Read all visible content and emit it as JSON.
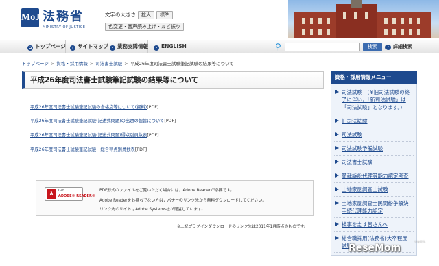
{
  "header": {
    "logo_mark": "MoJ",
    "logo_jp": "法務省",
    "logo_en": "MINISTRY OF JUSTICE",
    "font_size_label": "文字の大きさ",
    "font_large": "拡大",
    "font_standard": "標準",
    "accessibility": "色変更・音声読み上げ・ルビ振り"
  },
  "nav": {
    "items": [
      {
        "label": "トップページ",
        "icon": "house-icon"
      },
      {
        "label": "サイトマップ",
        "icon": "chevron-right-icon"
      },
      {
        "label": "業務支障情報",
        "icon": "chevron-right-icon"
      },
      {
        "label": "ENGLISH",
        "icon": "chevron-right-icon"
      }
    ],
    "search_placeholder": "",
    "search_button": "検索",
    "advanced_search": "詳細検索"
  },
  "breadcrumb": {
    "items": [
      "トップページ",
      "資格・採用情報",
      "司法書士試験"
    ],
    "current": "平成26年度司法書士試験筆記試験の結果等について"
  },
  "page_title": "平成26年度司法書士試験筆記試験の結果等について",
  "documents": [
    {
      "text": "平成26年度司法書士試験筆記試験の合格点等について(資料)",
      "suffix": "[PDF]"
    },
    {
      "text": "平成26年度司法書士試験筆記試験(記述式問題)の出題の趣旨について",
      "suffix": "[PDF]"
    },
    {
      "text": "平成26年度司法書士試験筆記試験(記述式問題)得点別員数表",
      "suffix": "[PDF]"
    },
    {
      "text": "平成26年度司法書士試験筆記試験　総合得点別員数表",
      "suffix": "[PDF]"
    }
  ],
  "adobe": {
    "badge_small": "Get",
    "badge_main": "ADOBE® READER®",
    "lines": [
      "PDF形式のファイルをご覧いただく場合には，Adobe Readerが必要です。",
      "Adobe Readerをお持ちでない方は，バナーのリンク先から無料ダウンロードしてください。",
      "リンク先のサイトはAdobe Systems社が運営しています。"
    ],
    "footnote": "※上記プラグインダウンロードのリンク先は2011年1月時点のものです。"
  },
  "sidebar": {
    "title": "資格・採用情報メニュー",
    "items": [
      "司法試験　(※旧司法試験の終了に伴い，「新司法試験」は「司法試験」となります。)",
      "旧司法試験",
      "司法試験",
      "司法試験予備試験",
      "司法書士試験",
      "簡裁訴訟代理等能力認定考査",
      "土地家屋調査士試験",
      "土地家屋調査士民間紛争解決手続代理能力認定",
      "検事を志す皆さんへ",
      "総合職採用(法務省)大卒程度試験"
    ]
  },
  "watermark": {
    "text": "ReseMom",
    "small": "リセマム"
  },
  "colors": {
    "brand": "#1e4a8e",
    "link": "#1e4a8e",
    "search_button": "#3c6cb0",
    "adobe_red": "#c8161d"
  }
}
